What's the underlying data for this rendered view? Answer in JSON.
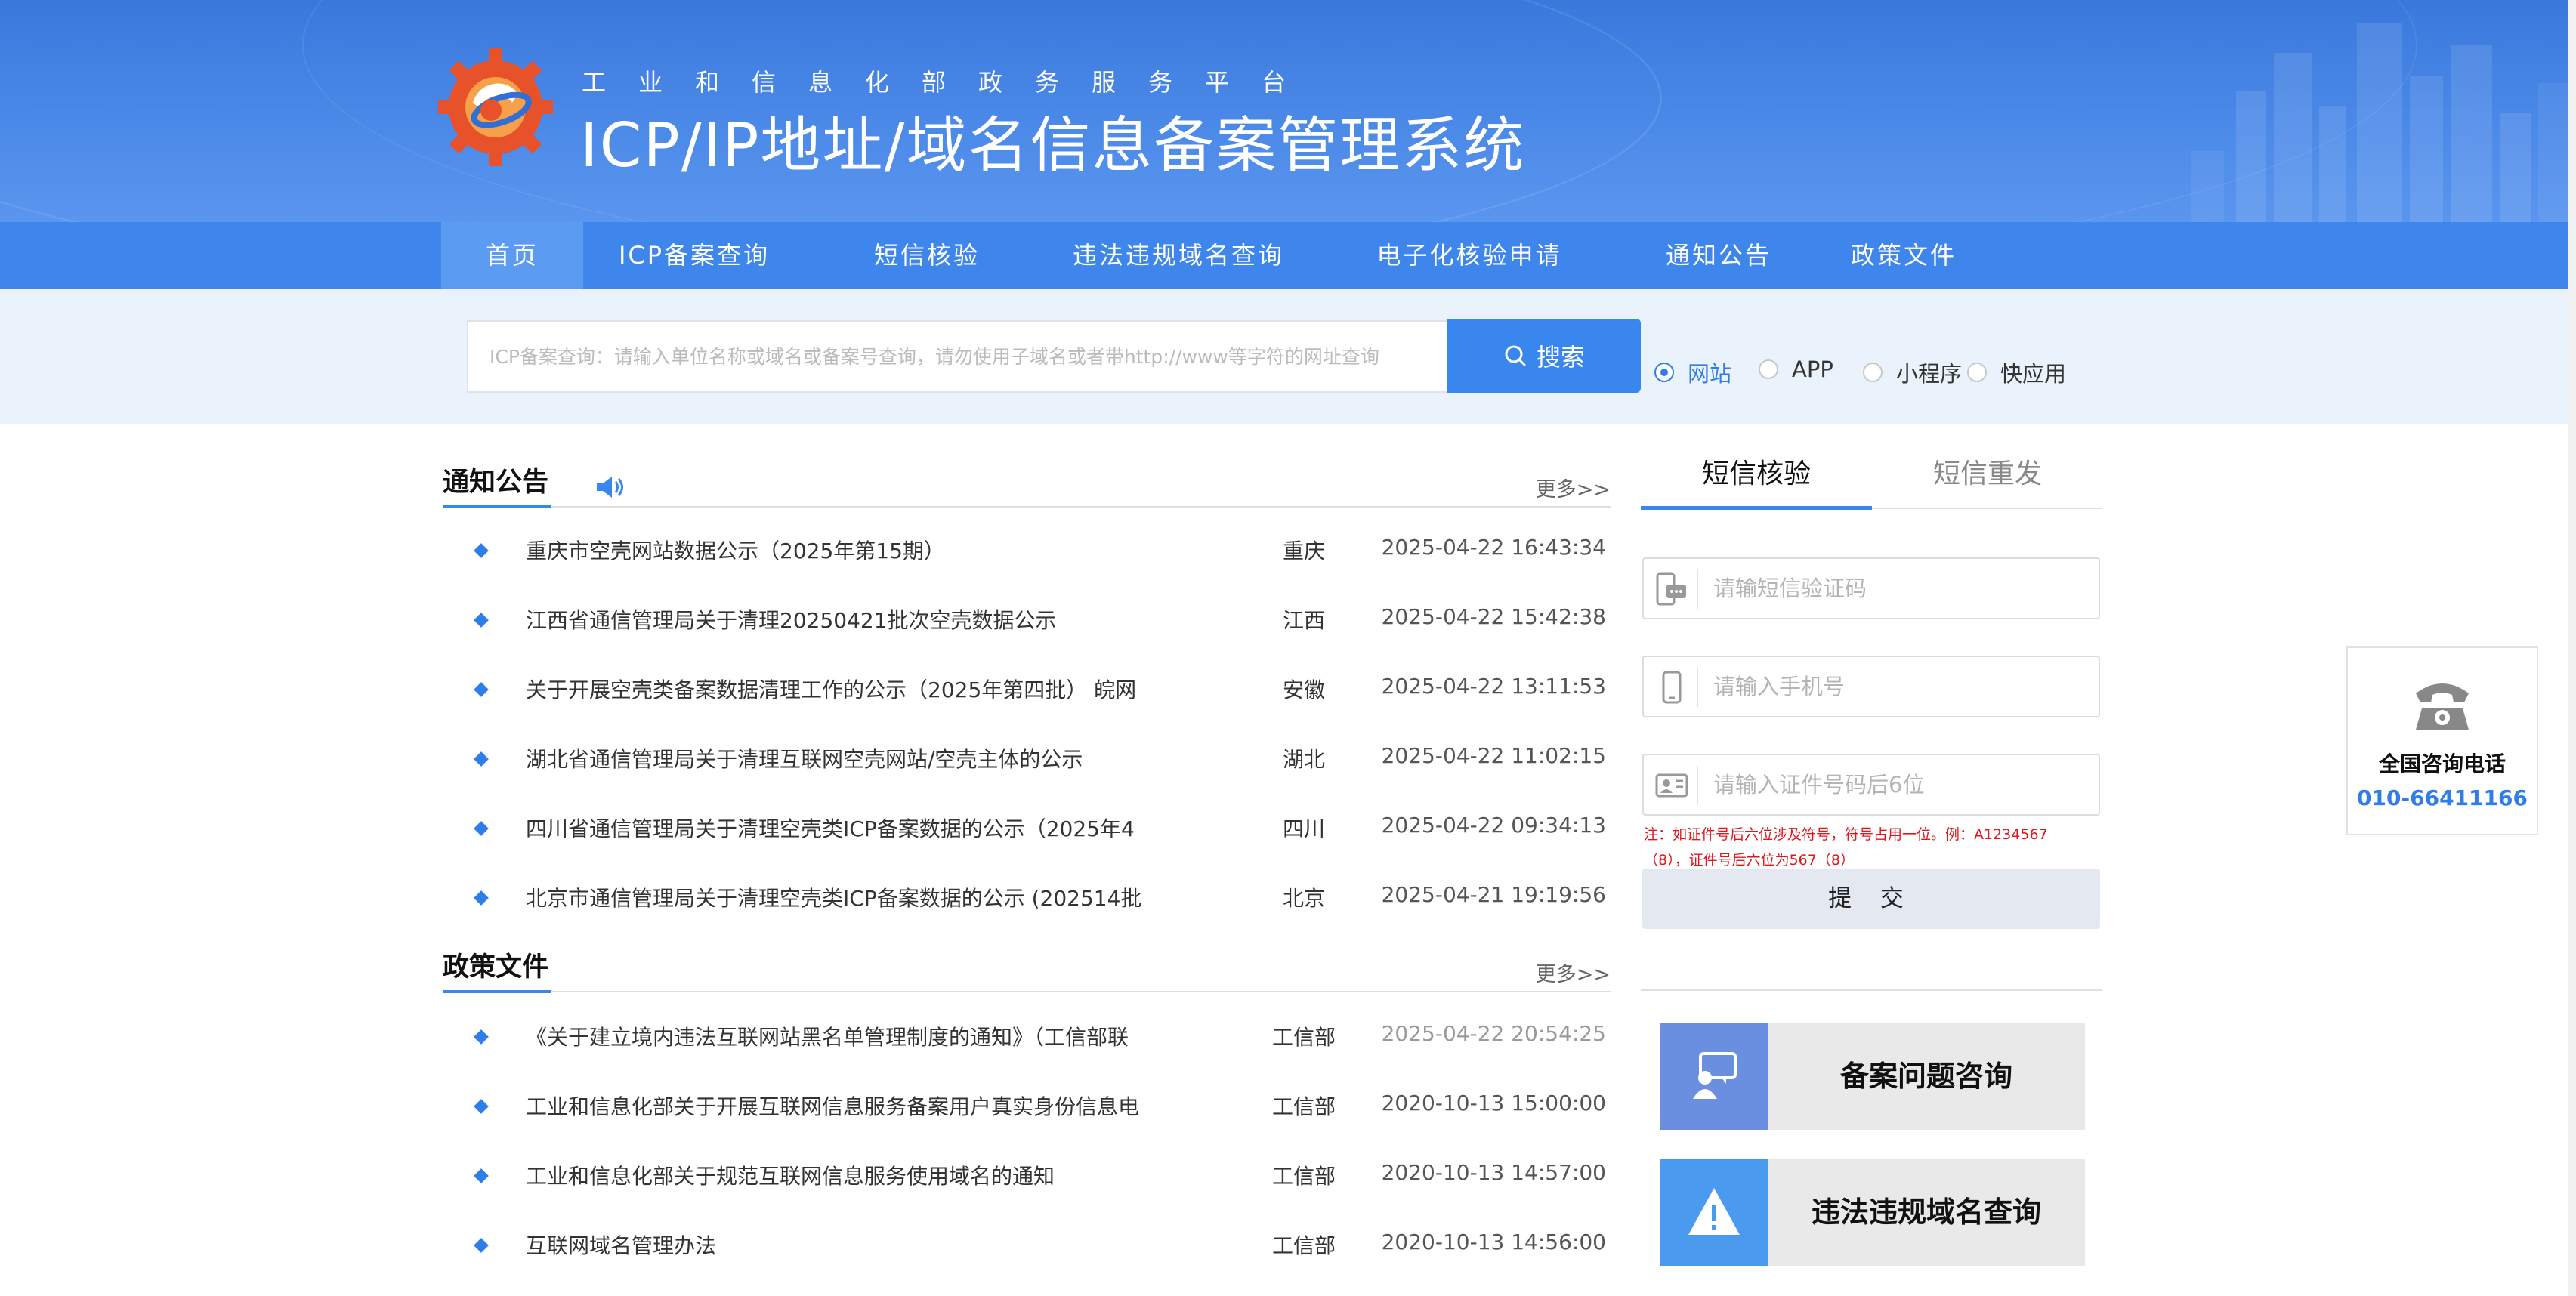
{
  "header": {
    "subtitle": "工业和信息化部政务服务平台",
    "title": "ICP/IP地址/域名信息备案管理系统"
  },
  "nav": {
    "items": [
      {
        "label": "首页"
      },
      {
        "label": "ICP备案查询"
      },
      {
        "label": "短信核验"
      },
      {
        "label": "违法违规域名查询"
      },
      {
        "label": "电子化核验申请"
      },
      {
        "label": "通知公告"
      },
      {
        "label": "政策文件"
      }
    ]
  },
  "search": {
    "placeholder": "ICP备案查询：请输入单位名称或域名或备案号查询，请勿使用子域名或者带http://www等字符的网址查询",
    "button_label": "搜索",
    "options": [
      "网站",
      "APP",
      "小程序",
      "快应用"
    ],
    "selected": "网站"
  },
  "notices": {
    "title": "通知公告",
    "more": "更多>>",
    "items": [
      {
        "name": "重庆市空壳网站数据公示（2025年第15期）",
        "region": "重庆",
        "time": "2025-04-22 16:43:34"
      },
      {
        "name": "江西省通信管理局关于清理20250421批次空壳数据公示",
        "region": "江西",
        "time": "2025-04-22 15:42:38"
      },
      {
        "name": "关于开展空壳类备案数据清理工作的公示（2025年第四批） 皖网",
        "region": "安徽",
        "time": "2025-04-22 13:11:53"
      },
      {
        "name": "湖北省通信管理局关于清理互联网空壳网站/空壳主体的公示",
        "region": "湖北",
        "time": "2025-04-22 11:02:15"
      },
      {
        "name": "四川省通信管理局关于清理空壳类ICP备案数据的公示（2025年4",
        "region": "四川",
        "time": "2025-04-22 09:34:13"
      },
      {
        "name": "北京市通信管理局关于清理空壳类ICP备案数据的公示 (202514批",
        "region": "北京",
        "time": "2025-04-21 19:19:56"
      }
    ]
  },
  "policies": {
    "title": "政策文件",
    "more": "更多>>",
    "items": [
      {
        "name": "《关于建立境内违法互联网站黑名单管理制度的通知》（工信部联",
        "region": "工信部",
        "time": "2025-04-22 20:54:25"
      },
      {
        "name": "工业和信息化部关于开展互联网信息服务备案用户真实身份信息电",
        "region": "工信部",
        "time": "2020-10-13 15:00:00"
      },
      {
        "name": "工业和信息化部关于规范互联网信息服务使用域名的通知",
        "region": "工信部",
        "time": "2020-10-13 14:57:00"
      },
      {
        "name": "互联网域名管理办法",
        "region": "工信部",
        "time": "2020-10-13 14:56:00"
      }
    ]
  },
  "sms": {
    "tabs": [
      "短信核验",
      "短信重发"
    ],
    "code_placeholder": "请输短信验证码",
    "phone_placeholder": "请输入手机号",
    "id_placeholder": "请输入证件号码后6位",
    "note_line1": "注：如证件号后六位涉及符号，符号占用一位。例：A1234567",
    "note_line2": "（8），证件号后六位为567（8）",
    "submit_label": "提 交"
  },
  "cards": [
    {
      "label": "备案问题咨询",
      "icon": "consult-icon",
      "color": "#6b8fe0"
    },
    {
      "label": "违法违规域名查询",
      "icon": "warning-icon",
      "color": "#4a9bf0"
    }
  ],
  "hotline": {
    "label": "全国咨询电话",
    "number": "010-66411166"
  },
  "colors": {
    "primary": "#3a86ef",
    "nav": "#3e86ec",
    "warning_text": "#e0161c"
  }
}
